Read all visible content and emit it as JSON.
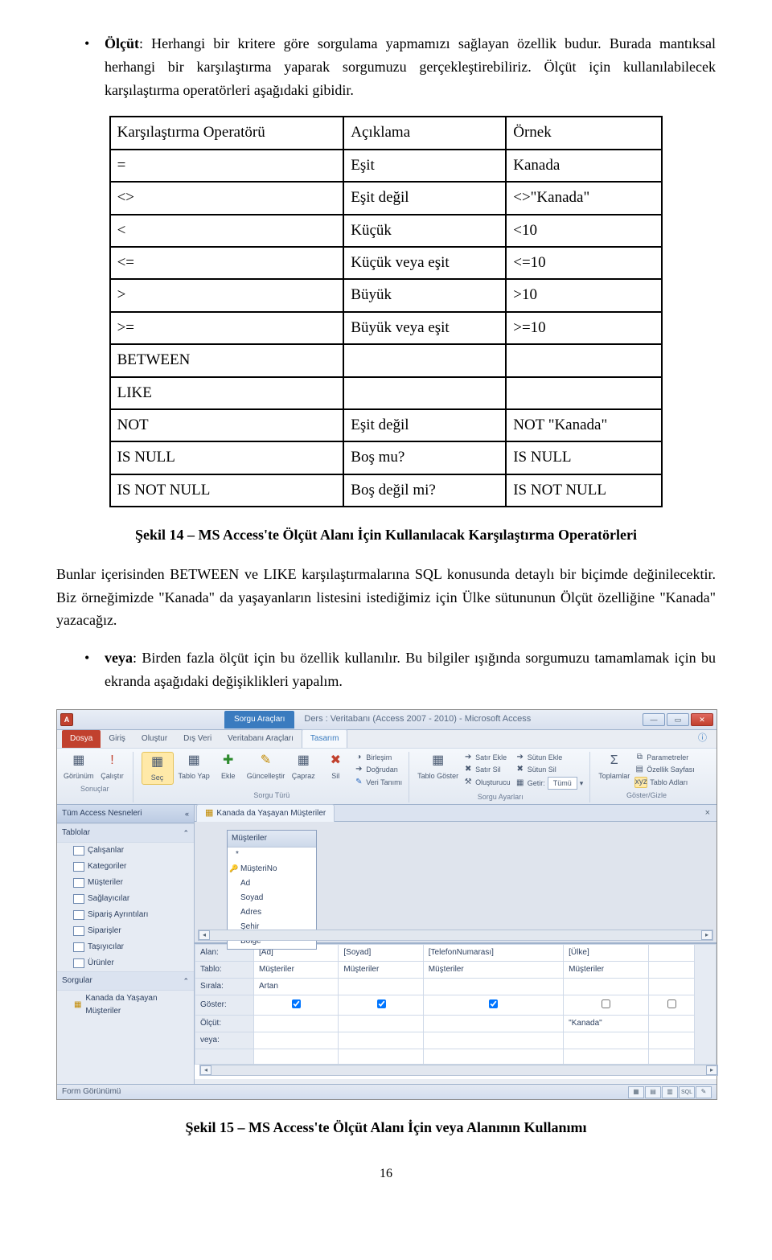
{
  "para1_lead": "Ölçüt",
  "para1_rest": ": Herhangi bir kritere göre sorgulama yapmamızı sağlayan özellik budur. Burada mantıksal herhangi bir karşılaştırma yaparak sorgumuzu gerçekleştirebiliriz. Ölçüt için kullanılabilecek karşılaştırma operatörleri aşağıdaki gibidir.",
  "table1": {
    "headers": [
      "Karşılaştırma Operatörü",
      "Açıklama",
      "Örnek"
    ],
    "rows": [
      [
        "=",
        "Eşit",
        "Kanada"
      ],
      [
        "<>",
        "Eşit değil",
        "<>\"Kanada\""
      ],
      [
        "<",
        "Küçük",
        "<10"
      ],
      [
        "<=",
        "Küçük veya eşit",
        "<=10"
      ],
      [
        ">",
        "Büyük",
        ">10"
      ],
      [
        ">=",
        "Büyük veya eşit",
        ">=10"
      ],
      [
        "BETWEEN",
        "",
        ""
      ],
      [
        "LIKE",
        "",
        ""
      ],
      [
        "NOT",
        "Eşit değil",
        "NOT \"Kanada\""
      ],
      [
        "IS NULL",
        "Boş mu?",
        "IS NULL"
      ],
      [
        "IS NOT NULL",
        "Boş değil mi?",
        "IS NOT NULL"
      ]
    ]
  },
  "caption1": "Şekil 14 – MS Access'te Ölçüt Alanı İçin Kullanılacak Karşılaştırma Operatörleri",
  "para2": "Bunlar içerisinden BETWEEN ve LIKE karşılaştırmalarına SQL konusunda detaylı bir biçimde değinilecektir. Biz örneğimizde \"Kanada\" da yaşayanların listesini istediğimiz için Ülke sütununun Ölçüt özelliğine \"Kanada\" yazacağız.",
  "para3_lead": "veya",
  "para3_rest": ": Birden fazla ölçüt için bu özellik kullanılır. Bu bilgiler ışığında sorgumuzu tamamlamak için bu ekranda aşağıdaki değişiklikleri yapalım.",
  "access": {
    "title_context": "Sorgu Araçları",
    "title": "Ders : Veritabanı (Access 2007 - 2010)  -  Microsoft Access",
    "tabs": {
      "file": "Dosya",
      "home": "Giriş",
      "create": "Oluştur",
      "ext": "Dış Veri",
      "dbtools": "Veritabanı Araçları",
      "design": "Tasarım"
    },
    "ribbon": {
      "view": "Görünüm",
      "run": "Çalıştır",
      "g1": "Sonuçlar",
      "sel": "Seç",
      "make": "Tablo Yap",
      "append": "Ekle",
      "update": "Güncelleştir",
      "cross": "Çapraz",
      "del": "Sil",
      "union": "Birleşim",
      "pass": "Doğrudan",
      "ddl": "Veri Tanımı",
      "g2": "Sorgu Türü",
      "show": "Tablo Göster",
      "insrow": "Satır Ekle",
      "delrow": "Satır Sil",
      "builder": "Oluşturucu",
      "inscol": "Sütun Ekle",
      "delcol": "Sütun Sil",
      "return": "Getir:",
      "return_v": "Tümü",
      "g3": "Sorgu Ayarları",
      "totals": "Toplamlar",
      "params": "Parametreler",
      "prop": "Özellik Sayfası",
      "tnames": "Tablo Adları",
      "g4": "Göster/Gizle"
    },
    "nav": {
      "header": "Tüm Access Nesneleri",
      "grp_tables": "Tablolar",
      "tables": [
        "Çalışanlar",
        "Kategoriler",
        "Müşteriler",
        "Sağlayıcılar",
        "Sipariş Ayrıntıları",
        "Siparişler",
        "Taşıyıcılar",
        "Ürünler"
      ],
      "grp_queries": "Sorgular",
      "queries": [
        "Kanada da Yaşayan Müşteriler"
      ]
    },
    "tab_open": "Kanada da Yaşayan Müşteriler",
    "fieldbox": {
      "title": "Müşteriler",
      "fields": [
        "*",
        "MüşteriNo",
        "Ad",
        "Soyad",
        "Adres",
        "Şehir",
        "Bölge"
      ]
    },
    "grid": {
      "labels": {
        "alan": "Alan:",
        "tablo": "Tablo:",
        "sirala": "Sırala:",
        "goster": "Göster:",
        "olcut": "Ölçüt:",
        "veya": "veya:"
      },
      "cols": [
        {
          "alan": "[Ad]",
          "tablo": "Müşteriler",
          "sirala": "Artan",
          "goster": true,
          "olcut": ""
        },
        {
          "alan": "[Soyad]",
          "tablo": "Müşteriler",
          "sirala": "",
          "goster": true,
          "olcut": ""
        },
        {
          "alan": "[TelefonNumarası]",
          "tablo": "Müşteriler",
          "sirala": "",
          "goster": true,
          "olcut": ""
        },
        {
          "alan": "[Ülke]",
          "tablo": "Müşteriler",
          "sirala": "",
          "goster": false,
          "olcut": "\"Kanada\""
        }
      ]
    },
    "status": "Form Görünümü"
  },
  "caption2": "Şekil 15 – MS Access'te Ölçüt Alanı İçin veya Alanının Kullanımı",
  "page_num": "16"
}
